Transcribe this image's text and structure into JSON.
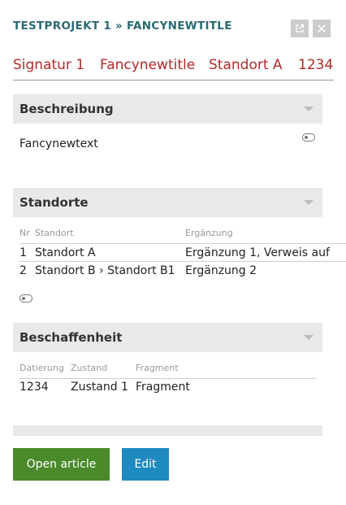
{
  "header": {
    "title": "TESTPROJEKT 1 » FANCYNEWTITLE",
    "popout_icon": "external-link-icon",
    "close_icon": "close-icon",
    "close_glyph": "✕"
  },
  "summary": {
    "signatur": "Signatur 1",
    "title": "Fancynewtitle",
    "standort": "Standort A",
    "datierung": "1234"
  },
  "sections": {
    "beschreibung": {
      "label": "Beschreibung",
      "text": "Fancynewtext"
    },
    "standorte": {
      "label": "Standorte",
      "columns": {
        "nr": "Nr",
        "standort": "Standort",
        "ergaenzung": "Ergänzung"
      },
      "rows": [
        {
          "nr": "1",
          "standort": "Standort A",
          "ergaenzung": "Ergänzung 1, Verweis auf"
        },
        {
          "nr": "2",
          "standort": "Standort B › Standort B1",
          "ergaenzung": "Ergänzung 2"
        }
      ]
    },
    "beschaffenheit": {
      "label": "Beschaffenheit",
      "columns": {
        "datierung": "Datierung",
        "zustand": "Zustand",
        "fragment": "Fragment"
      },
      "rows": [
        {
          "datierung": "1234",
          "zustand": "Zustand 1",
          "fragment": "Fragment"
        }
      ]
    }
  },
  "footer": {
    "open_label": "Open article",
    "edit_label": "Edit"
  },
  "colors": {
    "title": "#2a6a73",
    "summary": "#b22a2a",
    "open_button": "#4a8a2a",
    "edit_button": "#1e8ac0"
  }
}
